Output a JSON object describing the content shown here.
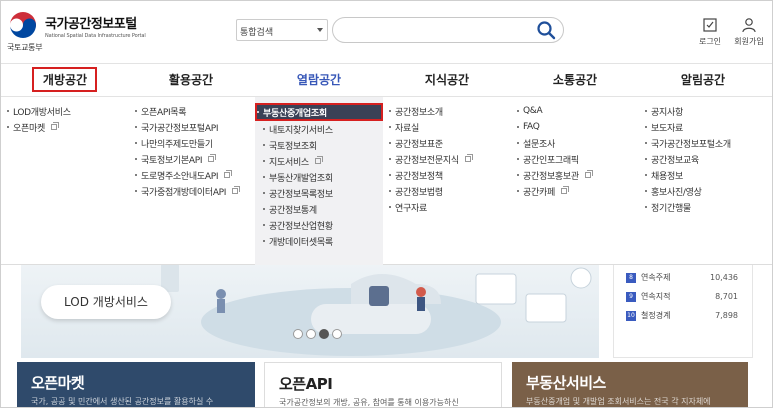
{
  "header": {
    "logo_title": "국가공간정보포털",
    "logo_subtitle": "National Spatial Data Infrastructure Portal",
    "ministry": "국토교통부",
    "search": {
      "select_label": "통합검색",
      "input_value": "",
      "input_placeholder": ""
    },
    "utils": [
      {
        "label": "로그인",
        "icon": "login-icon"
      },
      {
        "label": "회원가입",
        "icon": "user-icon"
      }
    ]
  },
  "gnb": [
    {
      "label": "개방공간"
    },
    {
      "label": "활용공간"
    },
    {
      "label": "열람공간"
    },
    {
      "label": "지식공간"
    },
    {
      "label": "소통공간"
    },
    {
      "label": "알림공간"
    }
  ],
  "mega_menu": [
    {
      "items": [
        {
          "label": "LOD개방서비스",
          "ext": false
        },
        {
          "label": "오픈마켓",
          "ext": true
        }
      ]
    },
    {
      "items": [
        {
          "label": "오픈API목록",
          "ext": false
        },
        {
          "label": "국가공간정보포털API",
          "ext": false
        },
        {
          "label": "나만의주제도만들기",
          "ext": false
        },
        {
          "label": "국토정보기본API",
          "ext": true
        },
        {
          "label": "도로명주소안내도API",
          "ext": true
        },
        {
          "label": "국가중점개방데이터API",
          "ext": true
        }
      ]
    },
    {
      "items": [
        {
          "label": "부동산중개업조회",
          "ext": false,
          "highlight": true
        },
        {
          "label": "내토지찾기서비스",
          "ext": false
        },
        {
          "label": "국토정보조회",
          "ext": false
        },
        {
          "label": "지도서비스",
          "ext": true
        },
        {
          "label": "부동산개발업조회",
          "ext": false
        },
        {
          "label": "공간정보목록정보",
          "ext": false
        },
        {
          "label": "공간정보통계",
          "ext": false
        },
        {
          "label": "공간정보산업현황",
          "ext": false
        },
        {
          "label": "개방데이터셋목록",
          "ext": false
        }
      ]
    },
    {
      "items": [
        {
          "label": "공간정보소개",
          "ext": false
        },
        {
          "label": "자료실",
          "ext": false
        },
        {
          "label": "공간정보표준",
          "ext": false
        },
        {
          "label": "공간정보전문지식",
          "ext": true
        },
        {
          "label": "공간정보정책",
          "ext": false
        },
        {
          "label": "공간정보법령",
          "ext": false
        },
        {
          "label": "연구자료",
          "ext": false
        }
      ]
    },
    {
      "items": [
        {
          "label": "Q&A",
          "ext": false
        },
        {
          "label": "FAQ",
          "ext": false
        },
        {
          "label": "설문조사",
          "ext": false
        },
        {
          "label": "공간인포그래픽",
          "ext": false
        },
        {
          "label": "공간정보홍보관",
          "ext": true
        },
        {
          "label": "공간카페",
          "ext": true
        }
      ]
    },
    {
      "items": [
        {
          "label": "공지사항",
          "ext": false
        },
        {
          "label": "보도자료",
          "ext": false
        },
        {
          "label": "국가공간정보포털소개",
          "ext": false
        },
        {
          "label": "공간정보교육",
          "ext": false
        },
        {
          "label": "채용정보",
          "ext": false
        },
        {
          "label": "홍보사진/영상",
          "ext": false
        },
        {
          "label": "정기간행물",
          "ext": false
        }
      ]
    }
  ],
  "banner": {
    "label": "LOD 개방서비스",
    "slides_total": 4,
    "slide_active": 3
  },
  "stats": [
    {
      "rank": "8",
      "label": "연속주제",
      "value": "10,436"
    },
    {
      "rank": "9",
      "label": "연속지적",
      "value": "8,701"
    },
    {
      "rank": "10",
      "label": "철정경계",
      "value": "7,898"
    }
  ],
  "cards": [
    {
      "title": "오픈마켓",
      "desc": "국가, 공공 및 민간에서 생산된 공간정보를 활용하실 수"
    },
    {
      "title": "오픈API",
      "desc": "국가공간정보의 개방, 공유, 참여를 통해 이용가능하신"
    },
    {
      "title": "부동산서비스",
      "desc": "부동산중개업 및 개발업 조회서비스는 전국 각 지자체에"
    }
  ],
  "colors": {
    "accent": "#3757b8",
    "highlight": "#d62020",
    "menu_selected_bg": "#3a4156"
  }
}
